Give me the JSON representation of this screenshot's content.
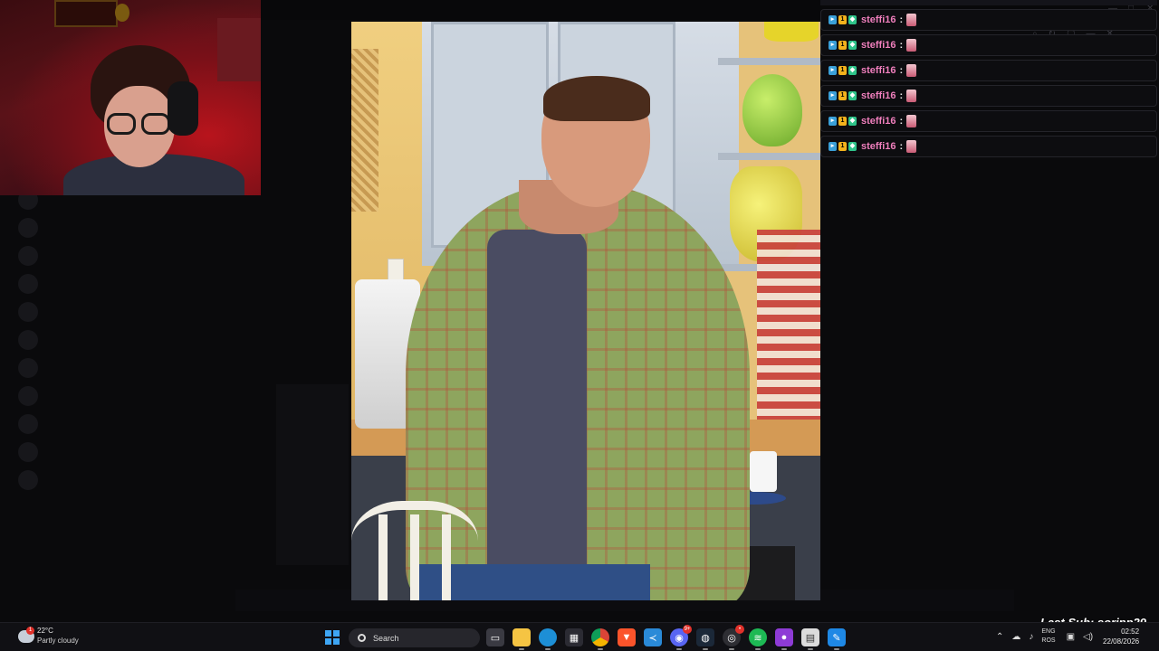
{
  "background_app": {
    "title": "",
    "channels": [
      "",
      "",
      "",
      "",
      "",
      "",
      "",
      "",
      "",
      "",
      ""
    ],
    "members": [
      "",
      "",
      "",
      "",
      "",
      "",
      ""
    ]
  },
  "chat": {
    "messages": [
      {
        "user": "steffi16",
        "separator": ":",
        "emote": "pink-figure-emote"
      },
      {
        "user": "steffi16",
        "separator": ":",
        "emote": "pink-figure-emote"
      },
      {
        "user": "steffi16",
        "separator": ":",
        "emote": "pink-figure-emote"
      },
      {
        "user": "steffi16",
        "separator": ":",
        "emote": "pink-figure-emote"
      },
      {
        "user": "steffi16",
        "separator": ":",
        "emote": "pink-figure-emote"
      },
      {
        "user": "steffi16",
        "separator": ":",
        "emote": "pink-figure-emote"
      }
    ],
    "username_color": "#f07fbd"
  },
  "overlay": {
    "last_sub": "Last Sub: sorinp29"
  },
  "taskbar": {
    "weather": {
      "temp": "22°C",
      "desc": "Partly cloudy",
      "badge": "1"
    },
    "search_label": "Search",
    "apps": [
      {
        "name": "task-view",
        "icon": "task-view-icon",
        "color": "#3a3a42"
      },
      {
        "name": "file-explorer",
        "icon": "folder-icon",
        "color": "#f5c443"
      },
      {
        "name": "edge",
        "icon": "edge-icon",
        "color": "#1d8fd6"
      },
      {
        "name": "store",
        "icon": "store-icon",
        "color": "#2b2b33"
      },
      {
        "name": "chrome",
        "icon": "chrome-icon",
        "color": "#db4437"
      },
      {
        "name": "brave",
        "icon": "brave-icon",
        "color": "#fb542b"
      },
      {
        "name": "vscode",
        "icon": "vscode-icon",
        "color": "#2a8ad8"
      },
      {
        "name": "discord",
        "icon": "discord-icon",
        "color": "#5865f2",
        "badge": "9+"
      },
      {
        "name": "steam",
        "icon": "steam-icon",
        "color": "#1b2838"
      },
      {
        "name": "obs",
        "icon": "obs-icon",
        "color": "#2e2e33",
        "badge": "•"
      },
      {
        "name": "spotify",
        "icon": "spotify-icon",
        "color": "#1db954"
      },
      {
        "name": "app-purple",
        "icon": "game-icon",
        "color": "#8e3bd6"
      },
      {
        "name": "app-doc",
        "icon": "document-icon",
        "color": "#dcdcdc"
      },
      {
        "name": "app-blue",
        "icon": "paint-icon",
        "color": "#1e88e5"
      }
    ],
    "tray": {
      "language": "ENG",
      "layout": "ROS",
      "time": "02:52",
      "date": "22/08/2026"
    }
  }
}
